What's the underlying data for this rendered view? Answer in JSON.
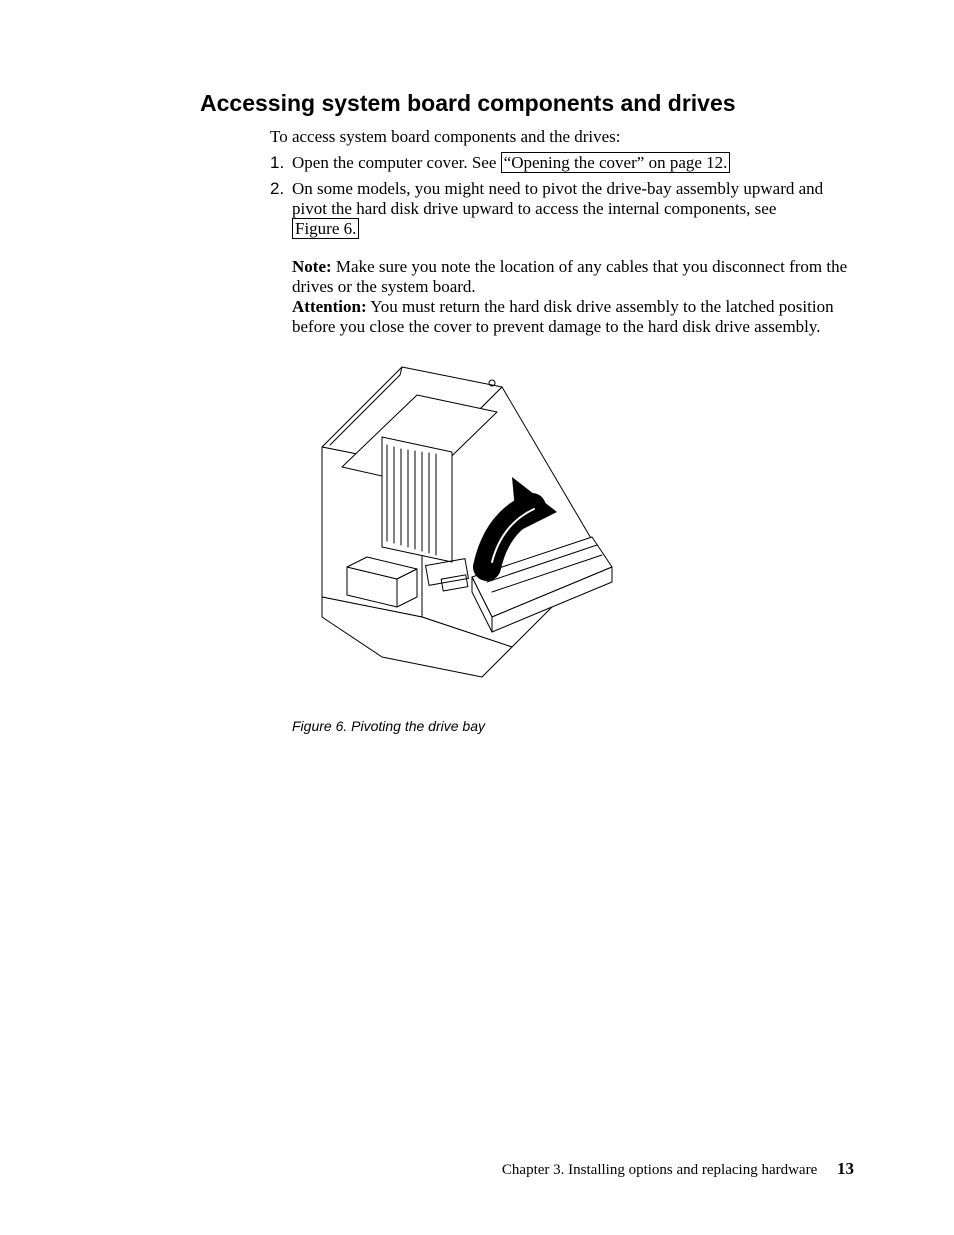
{
  "heading": "Accessing system board components and drives",
  "intro": "To access system board components and the drives:",
  "items": [
    {
      "num": "1.",
      "pre": "Open the computer cover. See ",
      "link": "“Opening the cover” on page 12.",
      "post": ""
    },
    {
      "num": "2.",
      "pre": "On some models, you might need to pivot the drive-bay assembly upward and pivot the hard disk drive upward to access the internal components, see ",
      "link": "Figure 6.",
      "post": "",
      "note_label": "Note:",
      "note_text": "  Make sure you note the location of any cables that you disconnect from the drives or the system board.",
      "attention_label": "Attention:",
      "attention_text": "   You must return the hard disk drive assembly to the latched position before you close the cover to prevent damage to the hard disk drive assembly."
    }
  ],
  "figure_caption": "Figure 6. Pivoting the drive bay",
  "footer_chapter": "Chapter 3. Installing options and replacing hardware",
  "footer_page": "13"
}
